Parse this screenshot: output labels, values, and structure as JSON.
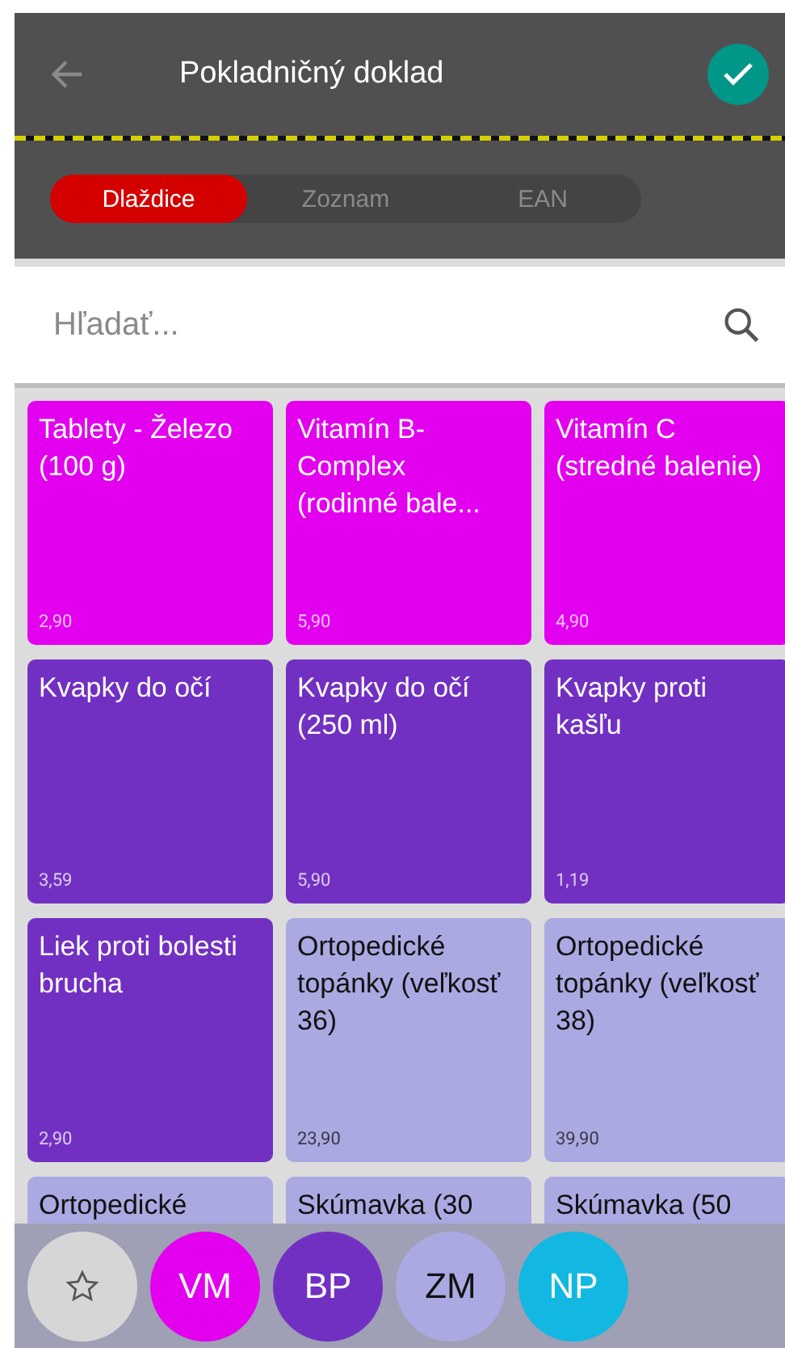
{
  "header": {
    "title": "Pokladničný doklad"
  },
  "tabs": [
    {
      "label": "Dlaždice",
      "selected": true
    },
    {
      "label": "Zoznam",
      "selected": false
    },
    {
      "label": "EAN",
      "selected": false
    }
  ],
  "search": {
    "placeholder": "Hľadať..."
  },
  "tiles": [
    {
      "name": "Tablety - Železo (100 g)",
      "price": "2,90",
      "color": "#e200ef"
    },
    {
      "name": "Vitamín B-Complex (rodinné bale...",
      "price": "5,90",
      "color": "#e200ef"
    },
    {
      "name": "Vitamín C (stredné balenie)",
      "price": "4,90",
      "color": "#e200ef"
    },
    {
      "name": "Kvapky do očí",
      "price": "3,59",
      "color": "#7230c2"
    },
    {
      "name": "Kvapky do očí (250 ml)",
      "price": "5,90",
      "color": "#7230c2"
    },
    {
      "name": "Kvapky proti kašľu",
      "price": "1,19",
      "color": "#7230c2"
    },
    {
      "name": "Liek proti bolesti brucha",
      "price": "2,90",
      "color": "#7230c2"
    },
    {
      "name": "Ortopedické topánky (veľkosť 36)",
      "price": "23,90",
      "color": "#aaa9e2"
    },
    {
      "name": "Ortopedické topánky (veľkosť 38)",
      "price": "39,90",
      "color": "#aaa9e2"
    },
    {
      "name": "Ortopedické",
      "color": "#aaa9e2"
    },
    {
      "name": "Skúmavka (30",
      "color": "#aaa9e2"
    },
    {
      "name": "Skúmavka (50",
      "color": "#aaa9e2"
    }
  ],
  "categories": [
    {
      "kind": "favorites",
      "color": "#d6d6d6"
    },
    {
      "kind": "group",
      "label": "VM",
      "color": "#e200ef"
    },
    {
      "kind": "group",
      "label": "BP",
      "color": "#7230c2"
    },
    {
      "kind": "group",
      "label": "ZM",
      "color": "#aaa9e2"
    },
    {
      "kind": "group",
      "label": "NP",
      "color": "#12b8e2"
    }
  ]
}
